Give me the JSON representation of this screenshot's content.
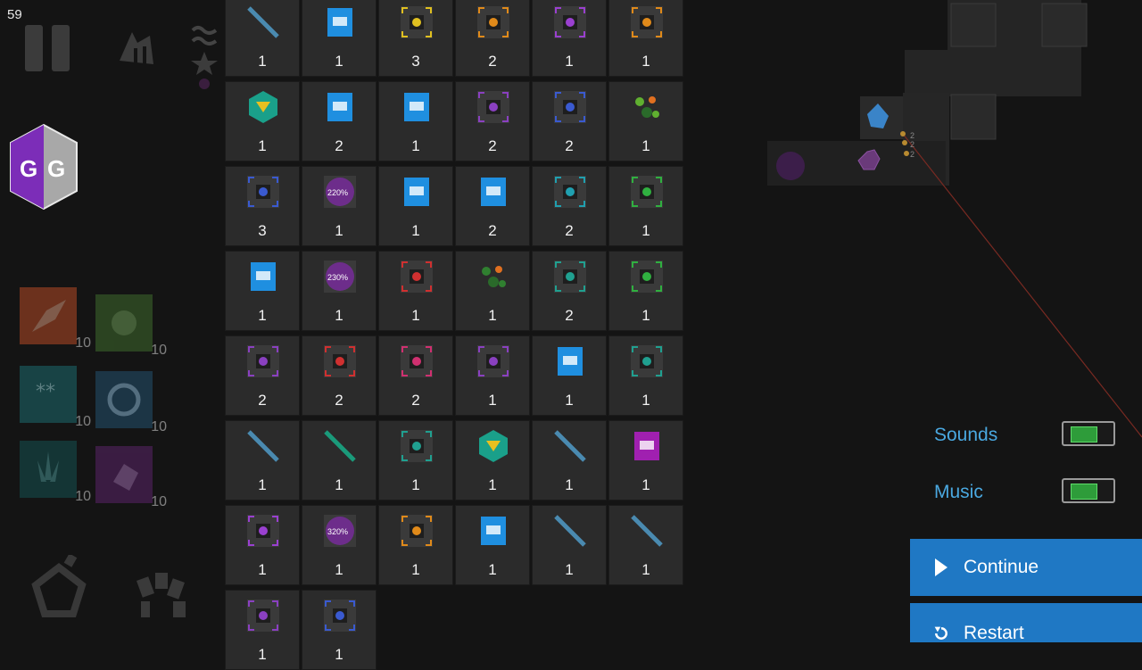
{
  "hud": {
    "fps": "59"
  },
  "abilities": [
    {
      "name": "fire-ability",
      "level": "10",
      "color": "#b54a25"
    },
    {
      "name": "poison-ability",
      "level": "10",
      "color": "#3e6b2c"
    },
    {
      "name": "freeze-ability",
      "level": "10",
      "color": "#1c6a6e"
    },
    {
      "name": "whirl-ability",
      "level": "10",
      "color": "#24506e"
    },
    {
      "name": "thorns-ability",
      "level": "10",
      "color": "#155050"
    },
    {
      "name": "loot-ability",
      "level": "10",
      "color": "#5a2468"
    }
  ],
  "inventory": [
    {
      "icon": "gun-tower-icon",
      "count": "1"
    },
    {
      "icon": "blueprint-icon",
      "count": "1"
    },
    {
      "icon": "gold-bonus-icon",
      "count": "3"
    },
    {
      "icon": "orange-chip-icon",
      "count": "2"
    },
    {
      "icon": "music-icon",
      "count": "1"
    },
    {
      "icon": "orange-chip-icon",
      "count": "1"
    },
    {
      "icon": "green-gem-icon",
      "count": "1"
    },
    {
      "icon": "blueprint-icon",
      "count": "2"
    },
    {
      "icon": "blueprint-icon",
      "count": "1"
    },
    {
      "icon": "purple-chip-icon",
      "count": "2"
    },
    {
      "icon": "blue-chip-icon",
      "count": "2"
    },
    {
      "icon": "colorful-resources-icon",
      "count": "1"
    },
    {
      "icon": "blue-chip-icon",
      "count": "3"
    },
    {
      "icon": "bonus-percent-icon",
      "count": "1",
      "badge": "220%"
    },
    {
      "icon": "blueprint-icon",
      "count": "1"
    },
    {
      "icon": "blueprint-icon",
      "count": "2"
    },
    {
      "icon": "xp-chip-icon",
      "count": "2"
    },
    {
      "icon": "green-chip-icon",
      "count": "1"
    },
    {
      "icon": "blueprint-icon",
      "count": "1"
    },
    {
      "icon": "bonus-percent-icon",
      "count": "1",
      "badge": "230%"
    },
    {
      "icon": "red-chip-icon",
      "count": "1"
    },
    {
      "icon": "green-resources-icon",
      "count": "1"
    },
    {
      "icon": "teal-chip-icon",
      "count": "2"
    },
    {
      "icon": "green-chip-icon",
      "count": "1"
    },
    {
      "icon": "purple-chip-icon",
      "count": "2"
    },
    {
      "icon": "red-chip-icon",
      "count": "2"
    },
    {
      "icon": "pink-chip-icon",
      "count": "2"
    },
    {
      "icon": "purple-chip-icon",
      "count": "1"
    },
    {
      "icon": "blueprint-icon",
      "count": "1"
    },
    {
      "icon": "teal-chip-icon",
      "count": "1"
    },
    {
      "icon": "gun-tower-icon",
      "count": "1"
    },
    {
      "icon": "green-stick-icon",
      "count": "1"
    },
    {
      "icon": "teal-chip-icon",
      "count": "1"
    },
    {
      "icon": "teal-gem-icon",
      "count": "1"
    },
    {
      "icon": "gun-tower-icon",
      "count": "1"
    },
    {
      "icon": "purple-blueprint-icon",
      "count": "1"
    },
    {
      "icon": "music-icon",
      "count": "1"
    },
    {
      "icon": "bonus-percent-icon",
      "count": "1",
      "badge": "320%"
    },
    {
      "icon": "orange-chip-icon",
      "count": "1"
    },
    {
      "icon": "blueprint-icon",
      "count": "1"
    },
    {
      "icon": "gun-tower-icon",
      "count": "1"
    },
    {
      "icon": "gun-tower-icon",
      "count": "1"
    },
    {
      "icon": "purple-chip-icon",
      "count": "1"
    },
    {
      "icon": "blue-chip-icon",
      "count": "1"
    }
  ],
  "settings": {
    "sounds_label": "Sounds",
    "music_label": "Music"
  },
  "menu": {
    "continue_label": "Continue",
    "restart_label": "Restart"
  },
  "map": {
    "enemy_counts": [
      "2",
      "2",
      "2"
    ]
  }
}
